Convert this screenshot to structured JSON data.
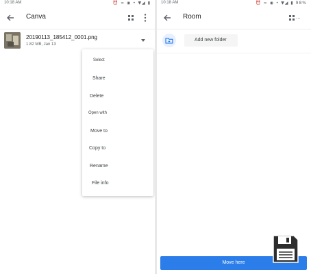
{
  "left": {
    "status": {
      "time": "10:18 AM",
      "icons": "⏰ ∞ ◉ • ▼◢ ▮"
    },
    "title": "Canva",
    "file": {
      "name": "20190113_185412_0001.png",
      "meta": "1.82 MB, Jan 13"
    },
    "menu": [
      {
        "label": "Select"
      },
      {
        "label": "Share"
      },
      {
        "label": "Delete"
      },
      {
        "label": "Open with"
      },
      {
        "label": "Move to"
      },
      {
        "label": "Copy to"
      },
      {
        "label": "Rename"
      },
      {
        "label": "File info"
      }
    ]
  },
  "right": {
    "status": {
      "time": "10:18 AM",
      "icons": "⏰ ∞ ◉ • ▼◢ ▮",
      "battery": "98%"
    },
    "title": "Room",
    "more": "...",
    "add_folder": "Add new folder",
    "move_here": "Move here"
  },
  "colors": {
    "accent": "#2b7de9",
    "divider": "#e8e8e8"
  }
}
